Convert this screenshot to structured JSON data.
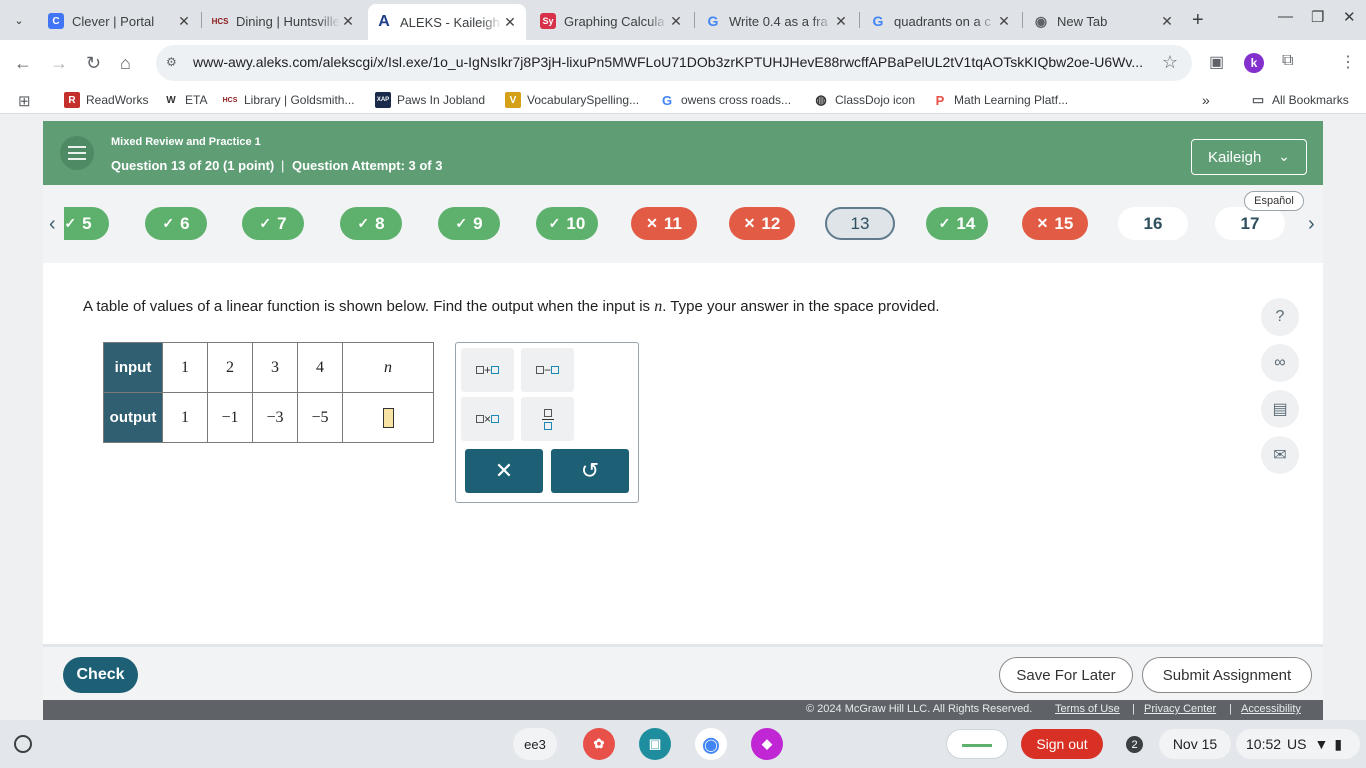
{
  "browser": {
    "tabs": [
      {
        "title": "Clever | Portal",
        "icon": "clever-icon",
        "color": "#4274f6",
        "glyph": "C"
      },
      {
        "title": "Dining | Huntsville",
        "icon": "hcs-icon",
        "color": "#ffffff",
        "glyph": "HCS"
      },
      {
        "title": "ALEKS - Kaileigh",
        "icon": "aleks-icon",
        "color": "#ffffff",
        "glyph": "A"
      },
      {
        "title": "Graphing Calcula",
        "icon": "symbolab-icon",
        "color": "#d8324a",
        "glyph": "Sy"
      },
      {
        "title": "Write 0.4 as a fra",
        "icon": "google-icon",
        "color": "#ffffff",
        "glyph": "G"
      },
      {
        "title": "quadrants on a c",
        "icon": "google-icon",
        "color": "#ffffff",
        "glyph": "G"
      },
      {
        "title": "New Tab",
        "icon": "chrome-icon",
        "color": "#ffffff",
        "glyph": "◉"
      }
    ],
    "url": "www-awy.aleks.com/alekscgi/x/Isl.exe/1o_u-IgNsIkr7j8P3jH-lixuPn5MWFLoU71DOb3zrKPTUHJHevE88rwcffAPBaPelUL2tV1tqAOTskKIQbw2oe-U6Wv...",
    "profile_initial": "k",
    "bookmarks": [
      {
        "label": "ReadWorks",
        "glyph": "R",
        "color": "#c4302b"
      },
      {
        "label": "ETA",
        "glyph": "W",
        "color": "#ffffff"
      },
      {
        "label": "Library | Goldsmith...",
        "glyph": "HCS",
        "color": "#ffffff"
      },
      {
        "label": "Paws In Jobland",
        "glyph": "XAP",
        "color": "#1a2a4a"
      },
      {
        "label": "VocabularySpelling...",
        "glyph": "V",
        "color": "#d4a017"
      },
      {
        "label": "owens cross roads...",
        "glyph": "G",
        "color": "#ffffff"
      },
      {
        "label": "ClassDojo icon",
        "glyph": "◍",
        "color": "#ffffff"
      },
      {
        "label": "Math Learning Platf...",
        "glyph": "P",
        "color": "#ffffff"
      }
    ],
    "all_bookmarks": "All Bookmarks"
  },
  "aleks": {
    "assignment_title": "Mixed Review and Practice 1",
    "question_label": "Question 13 of 20 (1 point)",
    "separator": "|",
    "attempt_label": "Question Attempt: 3 of 3",
    "user_name": "Kaileigh",
    "espanol": "Español",
    "questions": [
      {
        "label": "5",
        "status": "correct"
      },
      {
        "label": "6",
        "status": "correct"
      },
      {
        "label": "7",
        "status": "correct"
      },
      {
        "label": "8",
        "status": "correct"
      },
      {
        "label": "9",
        "status": "correct"
      },
      {
        "label": "10",
        "status": "correct"
      },
      {
        "label": "11",
        "status": "wrong"
      },
      {
        "label": "12",
        "status": "wrong"
      },
      {
        "label": "13",
        "status": "current"
      },
      {
        "label": "14",
        "status": "correct"
      },
      {
        "label": "15",
        "status": "wrong"
      },
      {
        "label": "16",
        "status": "open"
      },
      {
        "label": "17",
        "status": "open"
      }
    ],
    "question_text_before": "A table of values of a linear function is shown below. Find the output when the input is ",
    "question_var": "n",
    "question_text_after": ". Type your answer in the space provided.",
    "table": {
      "input_label": "input",
      "output_label": "output",
      "inputs": [
        "1",
        "2",
        "3",
        "4",
        "n"
      ],
      "outputs": [
        "1",
        "−1",
        "−3",
        "−5",
        ""
      ]
    },
    "palette": {
      "add_symbol": "+",
      "subtract_symbol": "−",
      "multiply_symbol": "×",
      "clear_symbol": "✕",
      "undo_symbol": "↺"
    },
    "check_label": "Check",
    "save_later_label": "Save For Later",
    "submit_label": "Submit Assignment",
    "copyright": "© 2024 McGraw Hill LLC. All Rights Reserved.",
    "terms": "Terms of Use",
    "privacy": "Privacy Center",
    "accessibility": "Accessibility"
  },
  "shelf": {
    "app_label": "ee3",
    "signout_label": "Sign out",
    "notification_count": "2",
    "date": "Nov 15",
    "time": "10:52",
    "locale": "US"
  }
}
